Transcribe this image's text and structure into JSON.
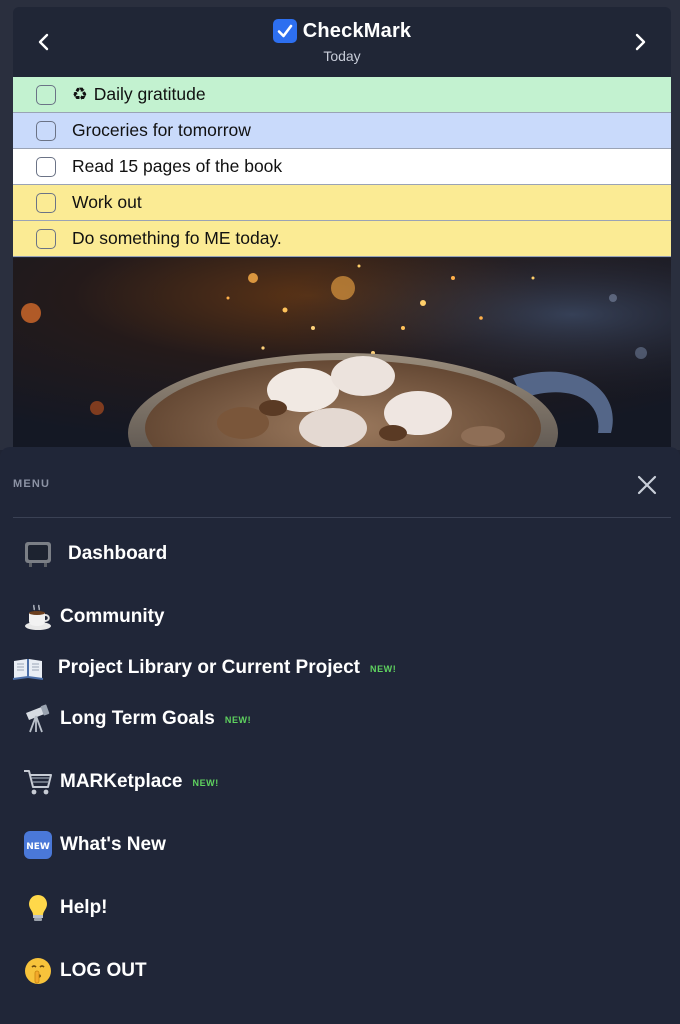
{
  "app": {
    "title": "CheckMark",
    "subtitle": "Today",
    "prev_icon": "‹",
    "next_icon": "›"
  },
  "tasks": [
    {
      "label": "Daily gratitude",
      "emoji": "♻",
      "color": "#c3f2d0",
      "checked": false
    },
    {
      "label": "Groceries for tomorrow",
      "emoji": "",
      "color": "#c9dafb",
      "checked": false
    },
    {
      "label": "Read 15 pages of the book",
      "emoji": "",
      "color": "#ffffff",
      "checked": false
    },
    {
      "label": "Work out",
      "emoji": "",
      "color": "#fbeb94",
      "checked": false
    },
    {
      "label": "Do something fo ME today.",
      "emoji": "",
      "color": "#fbeb94",
      "checked": false
    }
  ],
  "menu": {
    "heading": "MENU",
    "new_badge": "NEW!",
    "items": [
      {
        "label": "Dashboard",
        "icon": "television-icon",
        "is_new": false
      },
      {
        "label": "Community",
        "icon": "coffee-cup-icon",
        "is_new": false
      },
      {
        "label": "Project Library or Current Project",
        "icon": "open-book-icon",
        "is_new": true
      },
      {
        "label": "Long Term Goals",
        "icon": "telescope-icon",
        "is_new": true
      },
      {
        "label": "MARKetplace",
        "icon": "shopping-cart-icon",
        "is_new": true
      },
      {
        "label": "What's New",
        "icon": "new-button-icon",
        "is_new": false
      },
      {
        "label": "Help!",
        "icon": "light-bulb-icon",
        "is_new": false
      },
      {
        "label": "LOG OUT",
        "icon": "shushing-face-icon",
        "is_new": false
      }
    ]
  },
  "colors": {
    "accent_green": "#5fd35f",
    "menu_bg": "#202638",
    "logo_blue": "#2d6ff0"
  }
}
